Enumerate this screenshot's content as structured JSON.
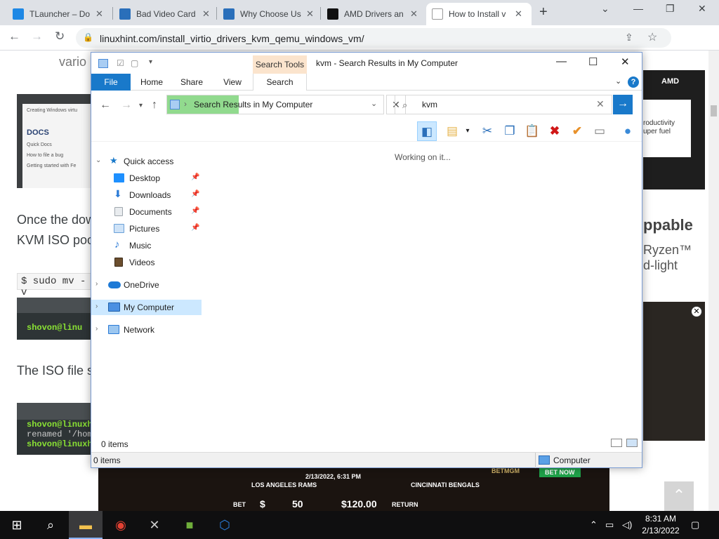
{
  "browser": {
    "tabs": [
      {
        "title": "TLauncher – Do",
        "color": "#1e88e5"
      },
      {
        "title": "Bad Video Card",
        "color": "#2a6fba"
      },
      {
        "title": "Why Choose Us",
        "color": "#2a6fba"
      },
      {
        "title": "AMD Drivers an",
        "color": "#111111"
      },
      {
        "title": "How to Install v",
        "color": "#e8eaed"
      }
    ],
    "url": "linuxhint.com/install_virtio_drivers_kvm_qemu_windows_vm/"
  },
  "page": {
    "snippet_top": "vario",
    "para1_line1": "Once the dow",
    "para1_line2": "KVM ISO poo",
    "code_inline": "$ sudo mv -v",
    "term1_line": "shovon@linu",
    "para2": "The ISO file s",
    "term2_lines": [
      "shovon@linuxhi",
      "renamed '/home",
      "shovon@linuxhi"
    ],
    "doc_shot": {
      "title": "Creating Windows virtu",
      "brand": "DOCS",
      "links": [
        "Quick Docs",
        "How to file a bug",
        "Getting started with Fe"
      ]
    },
    "right_ad": {
      "logo": "AMD",
      "text1": "roductivity",
      "text2": "uper fuel"
    },
    "right_text": [
      "ppable",
      "Ryzen™",
      "d-light"
    ],
    "bottom_ad": {
      "team1": "LOS ANGELES RAMS",
      "date": "2/13/2022, 6:31 PM",
      "team2": "CINCINNATI BENGALS",
      "bet": "BET",
      "amount1": "$",
      "amount1b": "50",
      "amount2": "$120.00",
      "return": "RETURN",
      "brand": "BETMGM",
      "cta": "BET NOW"
    }
  },
  "explorer": {
    "title": "kvm - Search Results in My Computer",
    "context_tab": "Search Tools",
    "ribbon_tabs": [
      "File",
      "Home",
      "Share",
      "View",
      "Search"
    ],
    "address": "Search Results in My Computer",
    "search_query": "kvm",
    "status_message": "Working on it...",
    "items_count": "0 items",
    "status_left": "0 items",
    "status_right": "Computer",
    "nav": [
      {
        "label": "Quick access",
        "icon": "star",
        "color": "#1979ca"
      },
      {
        "label": "Desktop",
        "icon": "desktop",
        "color": "#1e90ff",
        "pinned": true
      },
      {
        "label": "Downloads",
        "icon": "download",
        "color": "#2a7ad6",
        "pinned": true
      },
      {
        "label": "Documents",
        "icon": "document",
        "color": "#9fa6ad",
        "pinned": true
      },
      {
        "label": "Pictures",
        "icon": "picture",
        "color": "#6aa0d8",
        "pinned": true
      },
      {
        "label": "Music",
        "icon": "music",
        "color": "#2a7ad6"
      },
      {
        "label": "Videos",
        "icon": "video",
        "color": "#6b4e2e"
      },
      {
        "label": "OneDrive",
        "icon": "cloud",
        "color": "#1e7ad6"
      },
      {
        "label": "My Computer",
        "icon": "computer",
        "color": "#4a90e2"
      },
      {
        "label": "Network",
        "icon": "network",
        "color": "#2a7ad6"
      }
    ]
  },
  "taskbar": {
    "time": "8:31 AM",
    "date": "2/13/2022"
  }
}
